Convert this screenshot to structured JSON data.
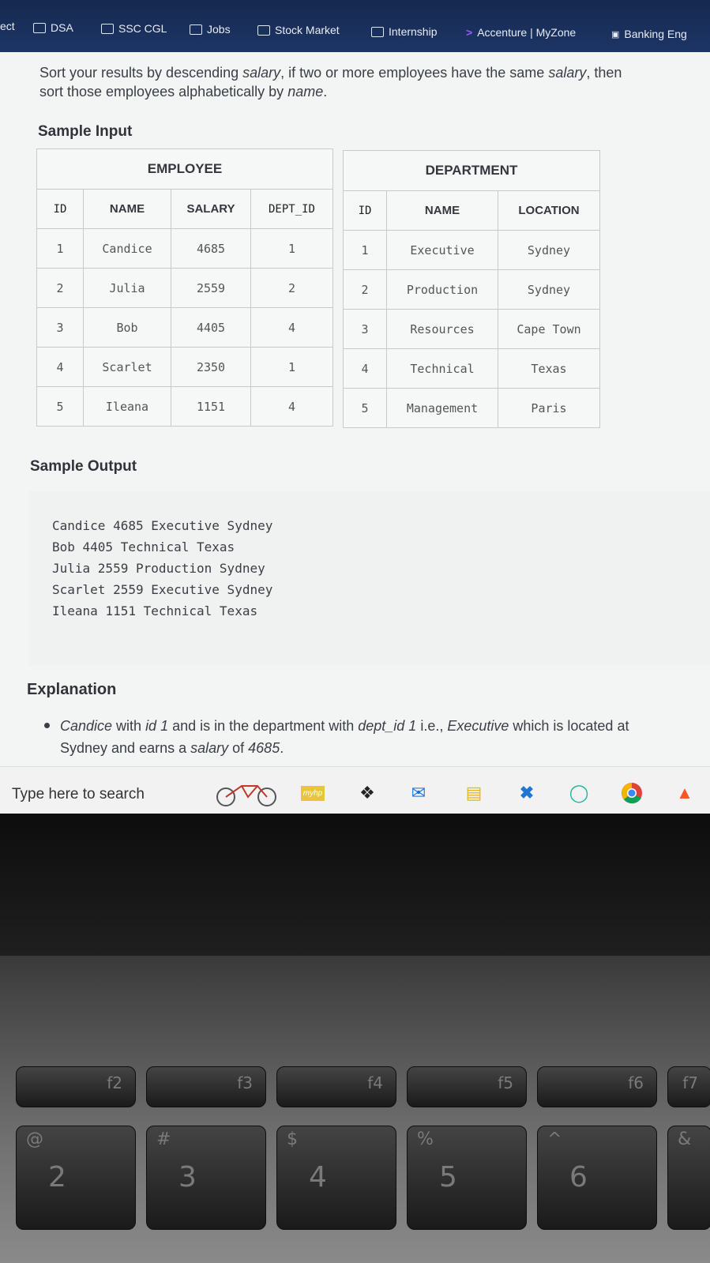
{
  "bookmarks": [
    "DSA",
    "SSC CGL",
    "Jobs",
    "Stock Market",
    "Internship",
    "Accenture | MyZone",
    "Banking Eng"
  ],
  "bookmark_edge_text": "ect",
  "instructions": {
    "line1_a": "Sort your results by descending ",
    "line1_salary": "salary",
    "line1_b": ", if two or more employees have the same ",
    "line1_salary2": "salary",
    "line1_c": ", then",
    "line2_a": "sort those employees alphabetically by ",
    "line2_name": "name",
    "line2_b": "."
  },
  "sample_input_heading": "Sample Input",
  "employee": {
    "caption": "EMPLOYEE",
    "headers": [
      "ID",
      "NAME",
      "SALARY",
      "DEPT_ID"
    ],
    "rows": [
      [
        "1",
        "Candice",
        "4685",
        "1"
      ],
      [
        "2",
        "Julia",
        "2559",
        "2"
      ],
      [
        "3",
        "Bob",
        "4405",
        "4"
      ],
      [
        "4",
        "Scarlet",
        "2350",
        "1"
      ],
      [
        "5",
        "Ileana",
        "1151",
        "4"
      ]
    ]
  },
  "department": {
    "caption": "DEPARTMENT",
    "headers": [
      "ID",
      "NAME",
      "LOCATION"
    ],
    "rows": [
      [
        "1",
        "Executive",
        "Sydney"
      ],
      [
        "2",
        "Production",
        "Sydney"
      ],
      [
        "3",
        "Resources",
        "Cape Town"
      ],
      [
        "4",
        "Technical",
        "Texas"
      ],
      [
        "5",
        "Management",
        "Paris"
      ]
    ]
  },
  "sample_output_heading": "Sample Output",
  "sample_output": [
    "Candice 4685 Executive Sydney",
    "Bob 4405 Technical Texas",
    "Julia 2559 Production Sydney",
    "Scarlet 2559 Executive Sydney",
    "Ileana 1151 Technical Texas"
  ],
  "explanation_heading": "Explanation",
  "explanation": {
    "a": "Candice",
    "b": " with ",
    "c": "id 1",
    "d": " and is in the department with ",
    "e": "dept_id 1",
    "f": " i.e., ",
    "g": "Executive",
    "h": " which is located at",
    "i": "Sydney and earns a ",
    "j": "salary",
    "k": " of ",
    "l": "4685",
    "m": "."
  },
  "taskbar": {
    "search_placeholder": "Type here to search",
    "myhp_label": "myhp"
  },
  "keyboard": {
    "fn_keys": [
      "f2",
      "f3",
      "f4",
      "f5",
      "f6",
      "f7"
    ],
    "symbols": [
      "@",
      "#",
      "$",
      "%",
      "^",
      "&"
    ],
    "numbers": [
      "2",
      "3",
      "4",
      "5",
      "6"
    ]
  }
}
